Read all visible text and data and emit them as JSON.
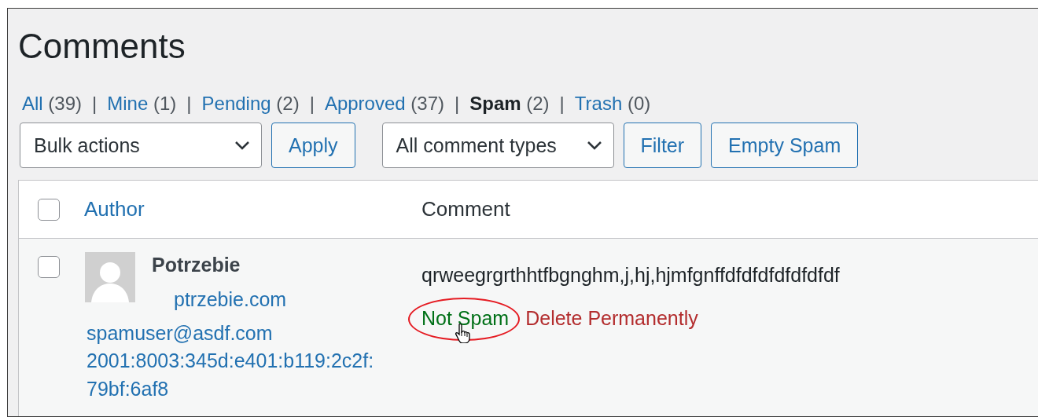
{
  "page": {
    "title": "Comments"
  },
  "filters": {
    "separator": "|",
    "items": [
      {
        "label": "All",
        "count": "(39)",
        "selected": false
      },
      {
        "label": "Mine",
        "count": "(1)",
        "selected": false
      },
      {
        "label": "Pending",
        "count": "(2)",
        "selected": false
      },
      {
        "label": "Approved",
        "count": "(37)",
        "selected": false
      },
      {
        "label": "Spam",
        "count": "(2)",
        "selected": true
      },
      {
        "label": "Trash",
        "count": "(0)",
        "selected": false
      }
    ]
  },
  "toolbar": [
    {
      "kind": "select",
      "value": "Bulk actions"
    },
    {
      "kind": "button",
      "label": "Apply"
    },
    {
      "kind": "select",
      "value": "All comment types"
    },
    {
      "kind": "button",
      "label": "Filter"
    },
    {
      "kind": "button",
      "label": "Empty Spam"
    }
  ],
  "table": {
    "header_checked": false,
    "columns": [
      {
        "label": "Author",
        "sortable": true
      },
      {
        "label": "Comment",
        "sortable": false
      }
    ],
    "rows": [
      {
        "checked": false,
        "author": "Potrzebie",
        "url": "ptrzebie.com",
        "email": "spamuser@asdf.com",
        "ip": "2001:8003:345d:e401:b119:2c2f:79bf:6af8",
        "comment": "qrweegrgrthhtfbgnghm,j,hj,hjmfgnffdfdfdfdfdfdfdf",
        "actions": [
          {
            "kind": "approve",
            "label": "Not Spam"
          },
          {
            "kind": "delete",
            "label": "Delete Permanently"
          }
        ]
      }
    ]
  }
}
